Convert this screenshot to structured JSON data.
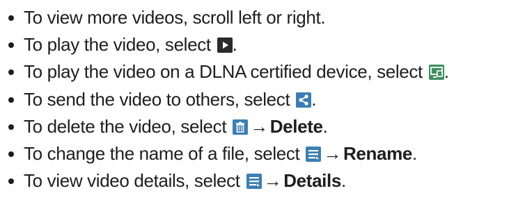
{
  "items": [
    {
      "text": "To view more videos, scroll left or right."
    },
    {
      "text": "To play the video, select ",
      "icon": "play-icon",
      "after": "."
    },
    {
      "text": "To play the video on a DLNA certified device, select ",
      "icon": "dlna-device-icon",
      "after": "."
    },
    {
      "text": "To send the video to others, select ",
      "icon": "share-icon",
      "after": "."
    },
    {
      "text": "To delete the video, select ",
      "icon": "trash-icon",
      "arrow": "→",
      "action": "Delete",
      "after": "."
    },
    {
      "text": "To change the name of a file, select ",
      "icon": "menu-icon",
      "arrow": "→",
      "action": "Rename",
      "after": "."
    },
    {
      "text": "To view video details, select ",
      "icon": "menu-icon",
      "arrow": "→",
      "action": "Details",
      "after": "."
    }
  ],
  "colors": {
    "text": "#1e1e1e",
    "icon_dark": "#2b2b2b",
    "icon_green": "#3f8f5e",
    "icon_blue": "#3a7fb5"
  }
}
